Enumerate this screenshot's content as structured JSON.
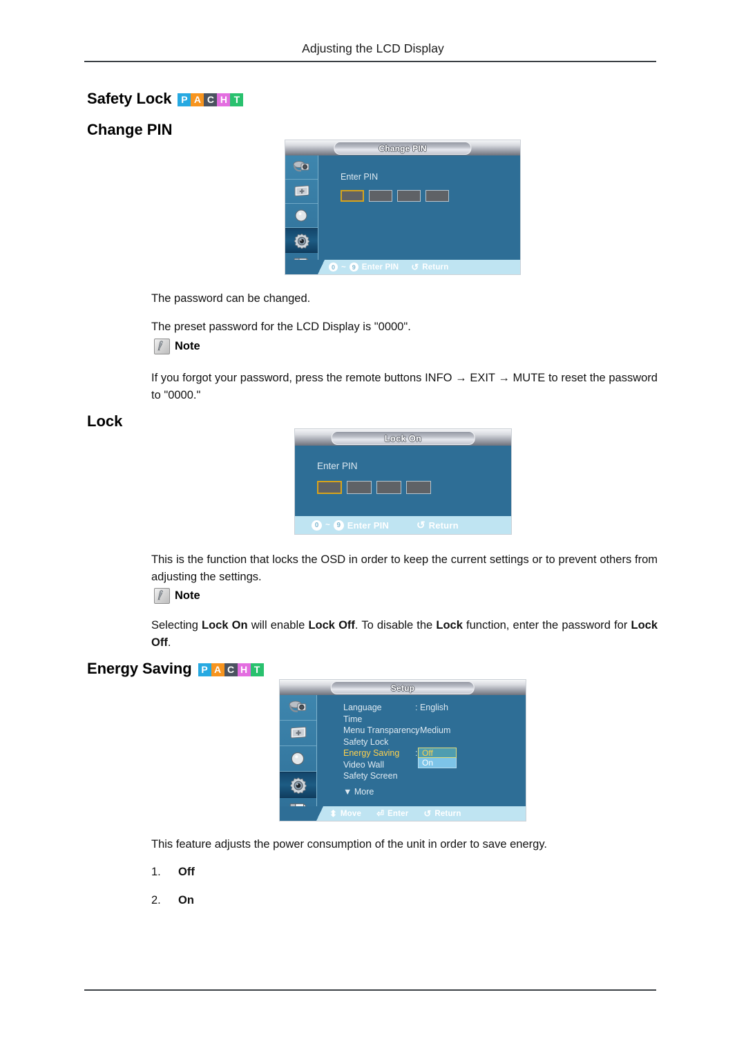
{
  "header": {
    "running_title": "Adjusting the LCD Display"
  },
  "colors": {
    "osd_body_blue": "#2e6e96",
    "osd_footer_blue": "#bfe4f2",
    "highlight_yellow": "#ffd24d",
    "selection_border": "#d8a41b",
    "pacht_p": "#27a9e1",
    "pacht_a": "#f7941e",
    "pacht_c": "#4b5360",
    "pacht_h": "#e36ee0",
    "pacht_t": "#29c16e"
  },
  "pacht_badge": {
    "letters": [
      "P",
      "A",
      "C",
      "H",
      "T"
    ]
  },
  "sections": {
    "safety_lock": {
      "heading": "Safety Lock",
      "has_badge": true
    },
    "change_pin": {
      "heading": "Change PIN",
      "osd": {
        "title": "Change PIN",
        "enter_pin_label": "Enter PIN",
        "pin_boxes": 4,
        "selected_box_index": 0,
        "sidebar_icons": [
          "input-source-icon",
          "picture-icon",
          "sound-speaker-icon",
          "setup-gear-icon",
          "multi-control-icon"
        ],
        "active_sidebar_index": 3,
        "footer": {
          "key_from": "0",
          "key_sep": "~",
          "key_to": "9",
          "key_label": "Enter PIN",
          "return_icon": "return-arrow-icon",
          "return_label": "Return"
        }
      },
      "paragraphs": [
        "The password can be changed.",
        "The preset password for the LCD Display is \"0000\"."
      ],
      "note_label": "Note",
      "note_body": "If you forgot your password, press the remote buttons INFO → EXIT → MUTE to reset the password to \"0000.\""
    },
    "lock": {
      "heading": "Lock",
      "osd": {
        "title": "Lock On",
        "enter_pin_label": "Enter PIN",
        "pin_boxes": 4,
        "selected_box_index": 0,
        "footer": {
          "key_from": "0",
          "key_sep": "~",
          "key_to": "9",
          "key_label": "Enter PIN",
          "return_icon": "return-arrow-icon",
          "return_label": "Return"
        }
      },
      "paragraph": "This is the function that locks the OSD in order to keep the current settings or to prevent others from adjusting the settings.",
      "note_label": "Note",
      "note_body": "Selecting Lock On will enable Lock Off. To disable the Lock function, enter the password for Lock Off.",
      "note_bold_terms": [
        "Lock On",
        "Lock Off",
        "Lock",
        "Lock Off"
      ]
    },
    "energy_saving": {
      "heading": "Energy Saving",
      "has_badge": true,
      "osd": {
        "title": "Setup",
        "sidebar_icons": [
          "input-source-icon",
          "picture-icon",
          "sound-speaker-icon",
          "setup-gear-icon",
          "multi-control-icon"
        ],
        "active_sidebar_index": 3,
        "menu_items": [
          {
            "label": "Language",
            "value": ": English",
            "highlighted": false
          },
          {
            "label": "Time",
            "value": "",
            "highlighted": false
          },
          {
            "label": "Menu Transparency",
            "value": ": Medium",
            "highlighted": false
          },
          {
            "label": "Safety Lock",
            "value": "",
            "highlighted": false
          },
          {
            "label": "Energy Saving",
            "value": ":",
            "highlighted": true
          },
          {
            "label": "Video Wall",
            "value": "",
            "highlighted": false
          },
          {
            "label": "Safety Screen",
            "value": "",
            "highlighted": false
          }
        ],
        "more_label": "▼ More",
        "dropdown": {
          "options": [
            "Off",
            "On"
          ],
          "selected": "Off"
        },
        "footer": {
          "move_icon": "up-down-arrow-icon",
          "move_label": "Move",
          "enter_icon": "enter-key-icon",
          "enter_label": "Enter",
          "return_icon": "return-arrow-icon",
          "return_label": "Return"
        }
      },
      "paragraph": "This feature adjusts the power consumption of the unit in order to save energy.",
      "list": [
        {
          "num": "1.",
          "value": "Off"
        },
        {
          "num": "2.",
          "value": "On"
        }
      ]
    }
  }
}
